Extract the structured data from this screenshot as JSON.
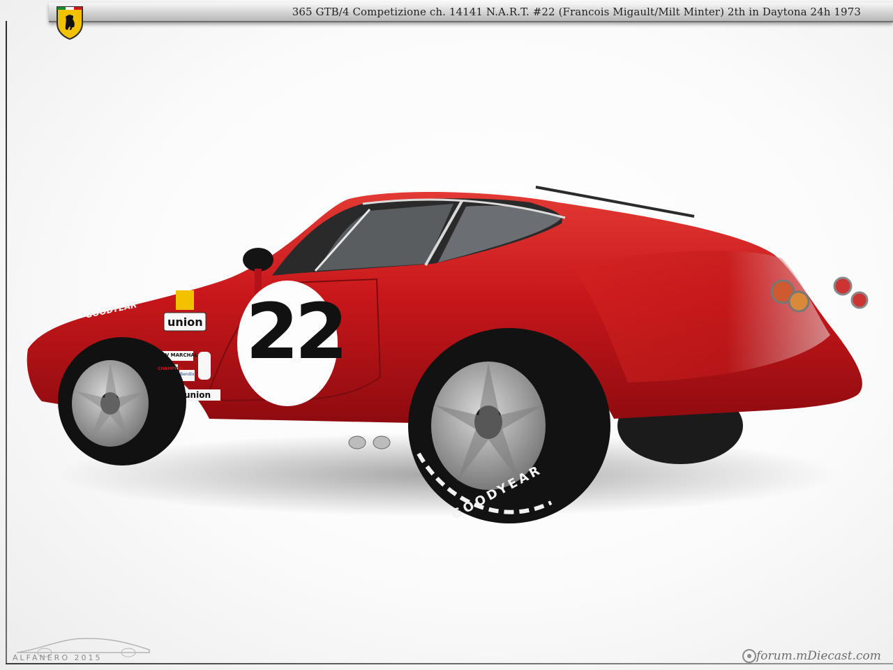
{
  "header": {
    "title": "365 GTB/4 Competizione  ch. 14141  N.A.R.T.  #22 (Francois Migault/Milt Minter)  2th in Daytona 24h 1973"
  },
  "badge": {
    "icon": "prancing-horse-shield-icon",
    "color": "#f2c200"
  },
  "car": {
    "race_number": "22",
    "body_color": "#c8171b",
    "sponsor_decals": [
      "GOODYEAR",
      "union",
      "union",
      "SEV MARCHAL",
      "CHAMPION",
      "prestolite",
      "Bendix"
    ],
    "tire_lettering": "GOODYEAR"
  },
  "watermarks": {
    "left": "ALFANERO 2015",
    "right": "forum.mDiecast.com"
  }
}
